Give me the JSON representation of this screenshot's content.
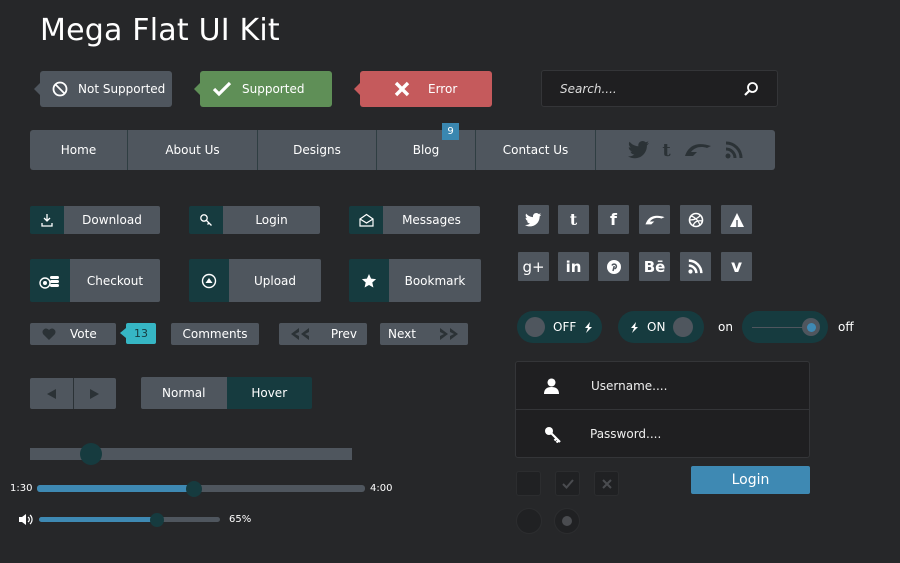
{
  "title": "Mega Flat UI Kit",
  "alerts": {
    "not_supported": "Not Supported",
    "supported": "Supported",
    "error": "Error"
  },
  "search": {
    "placeholder": "Search...."
  },
  "nav": {
    "items": [
      "Home",
      "About Us",
      "Designs",
      "Blog",
      "Contact Us"
    ],
    "blog_badge": "9",
    "social": [
      "twitter-icon",
      "tumblr-icon",
      "deviantart-icon",
      "rss-icon"
    ]
  },
  "buttons": {
    "download": "Download",
    "login": "Login",
    "messages": "Messages",
    "checkout": "Checkout",
    "upload": "Upload",
    "bookmark": "Bookmark",
    "vote": "Vote",
    "vote_count": "13",
    "comments": "Comments",
    "prev": "Prev",
    "next": "Next",
    "normal": "Normal",
    "hover": "Hover"
  },
  "social_grid": [
    "twitter-icon",
    "tumblr-icon",
    "facebook-icon",
    "deviantart-icon",
    "dribbble-icon",
    "forrst-icon",
    "googleplus-icon",
    "linkedin-icon",
    "pinterest-icon",
    "behance-icon",
    "rss-icon",
    "vimeo-icon"
  ],
  "toggles": {
    "off": "OFF",
    "on": "ON",
    "on_label": "on",
    "off_label": "off"
  },
  "login_form": {
    "username_placeholder": "Username....",
    "password_placeholder": "Password....",
    "button": "Login"
  },
  "player": {
    "current": "1:30",
    "total": "4:00",
    "progress": 0.48,
    "volume_label": "65%",
    "volume": 0.65,
    "slider": 0.19
  },
  "colors": {
    "bg": "#262729",
    "panel": "#4f565e",
    "dark_teal": "#163b3f",
    "blue": "#3e89b3",
    "success": "#5f8f57",
    "error": "#c55a5c"
  }
}
